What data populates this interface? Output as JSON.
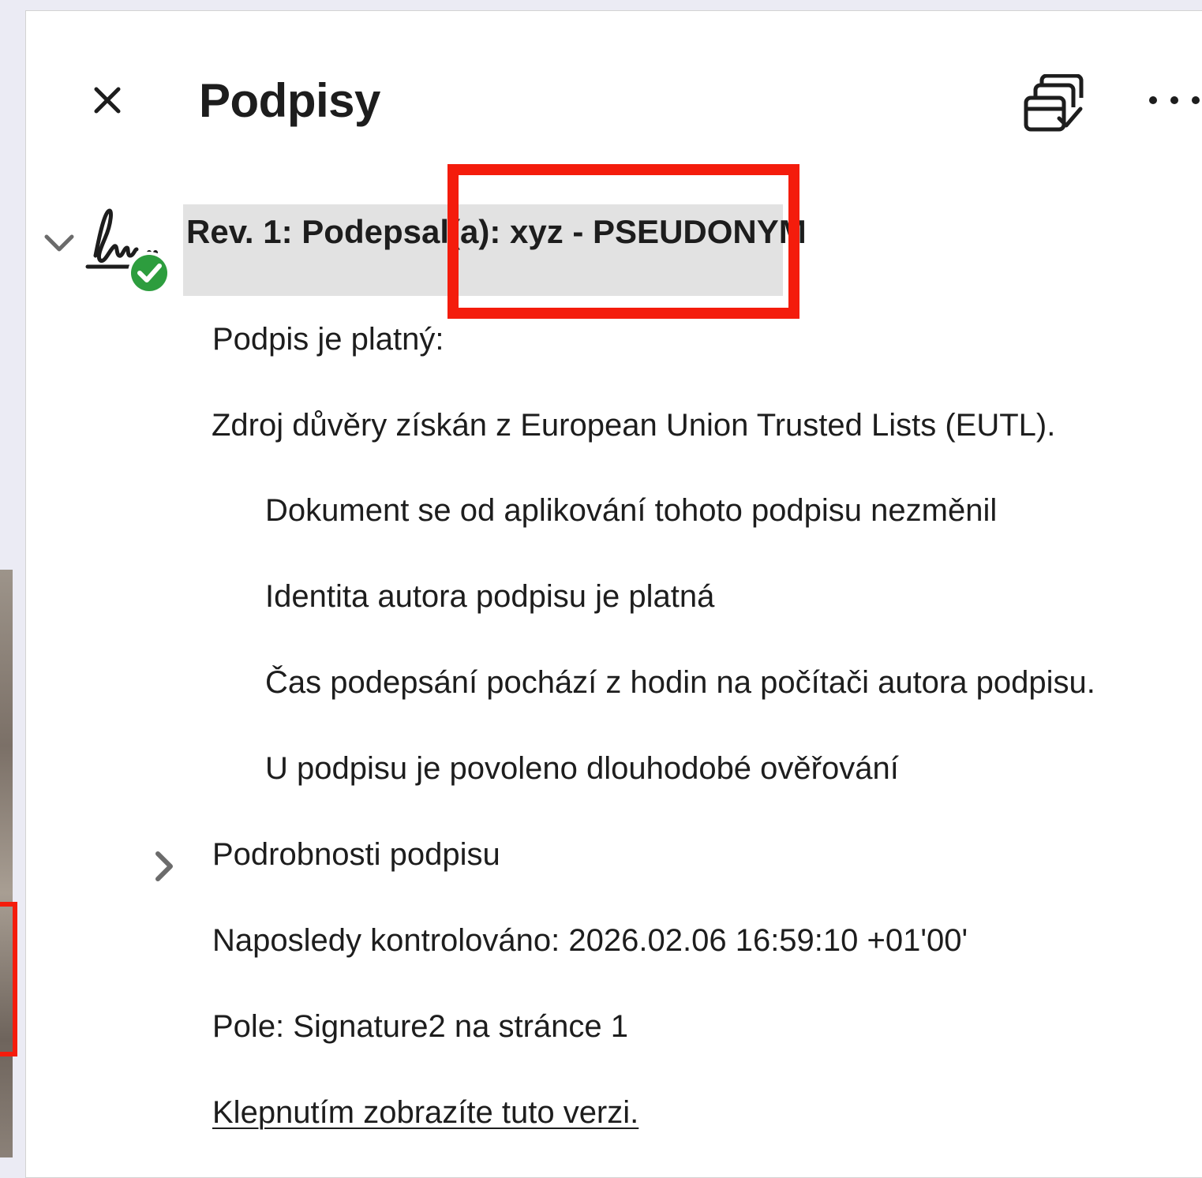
{
  "panel": {
    "title": "Podpisy",
    "close_icon": "close-icon",
    "validate_icon": "validate-all-icon",
    "more_icon": "more-options-icon"
  },
  "signature": {
    "revision_label": "Rev. 1: Podepsal(a): xyz - PSEUDONYM",
    "status_icon": "signature-valid-icon",
    "status": "Podpis je platný:",
    "trust_source": "Zdroj důvěry získán z European Union Trusted Lists (EUTL).",
    "checks": [
      "Dokument se od aplikování tohoto podpisu nezměnil",
      "Identita autora podpisu je platná",
      "Čas podepsání pochází z hodin na počítači autora podpisu.",
      "U podpisu je povoleno dlouhodobé ověřování"
    ],
    "details_label": "Podrobnosti podpisu",
    "last_checked": "Naposledy kontrolováno: 2026.02.06 16:59:10 +01'00'",
    "field": "Pole: Signature2 na stránce 1",
    "view_version_link": "Klepnutím zobrazíte tuto verzi."
  },
  "colors": {
    "highlight_red": "#f41c0c",
    "valid_green": "#2d9d3e",
    "row_selected_bg": "#e2e2e2"
  }
}
